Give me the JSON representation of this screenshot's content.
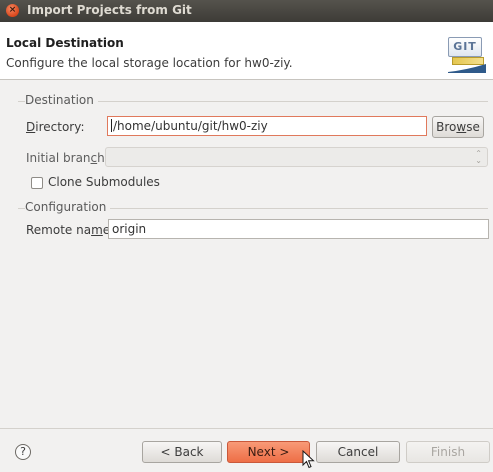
{
  "window": {
    "title": "Import Projects from Git",
    "close_glyph": "×"
  },
  "header": {
    "title": "Local Destination",
    "description": "Configure the local storage location for hw0-ziy.",
    "logo_text": "GIT"
  },
  "destination": {
    "group_label": "Destination",
    "directory_label_prefix": "D",
    "directory_label_rest": "irectory:",
    "directory_value": "/home/ubuntu/git/hw0-ziy",
    "browse_prefix": "Bro",
    "browse_mnemonic": "w",
    "browse_rest": "se",
    "branch_label_prefix": "Initial bran",
    "branch_label_mnemonic": "c",
    "branch_label_rest": "h:",
    "branch_value": "",
    "clone_submodules_label": "Clone Submodules",
    "clone_submodules_checked": false
  },
  "configuration": {
    "group_label": "Configuration",
    "remote_label_prefix": "Remote na",
    "remote_label_mnemonic": "m",
    "remote_label_rest": "e:",
    "remote_value": "origin"
  },
  "footer": {
    "help_glyph": "?",
    "back_label": "< Back",
    "next_label": "Next >",
    "cancel_label": "Cancel",
    "finish_label": "Finish"
  },
  "colors": {
    "accent": "#ee6e46",
    "titlebar": "#3d3b37"
  }
}
